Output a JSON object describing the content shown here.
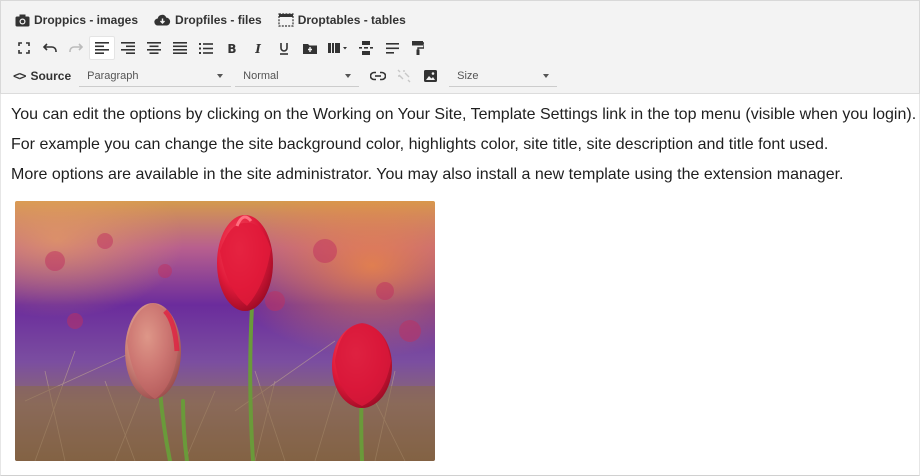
{
  "plugins": [
    {
      "label": "Droppics - images",
      "icon": "camera-icon"
    },
    {
      "label": "Dropfiles - files",
      "icon": "cloud-icon"
    },
    {
      "label": "Droptables - tables",
      "icon": "table-icon"
    }
  ],
  "toolbar": {
    "source_label": "Source",
    "format_select": "Paragraph",
    "style_select": "Normal",
    "size_select": "Size"
  },
  "content": {
    "paragraphs": [
      "You can edit the options by clicking on the Working on Your Site, Template Settings link in the top menu (visible when you login).",
      "For example you can change the site background color, highlights color, site title, site description and title font used.",
      "More options are available in the site administrator. You may also install a new template using the extension manager."
    ]
  },
  "colors": {
    "toolbar_bg": "#f3f3f3",
    "icon": "#333333",
    "tulip": "#e01a3a"
  }
}
